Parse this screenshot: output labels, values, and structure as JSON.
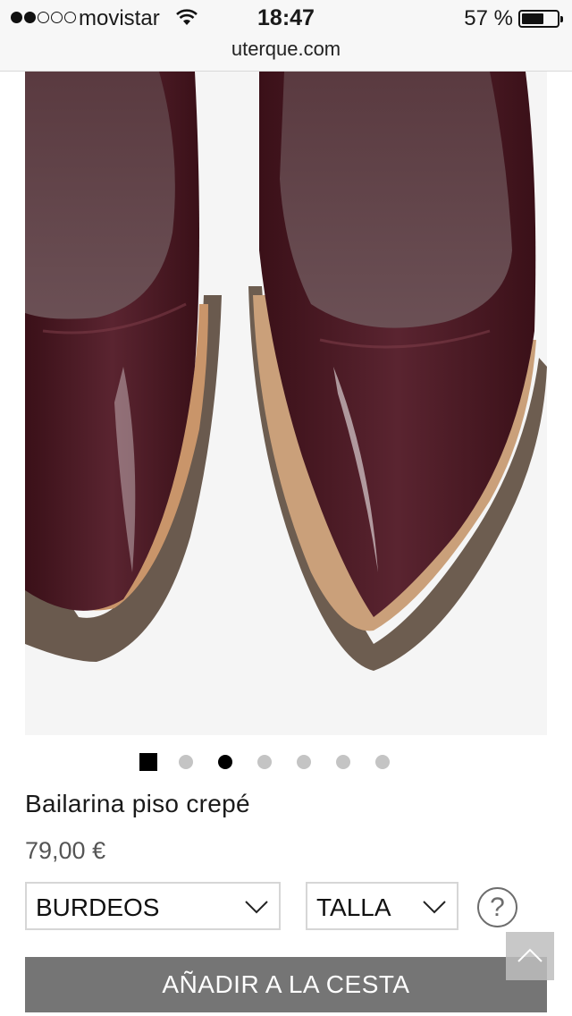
{
  "status_bar": {
    "carrier": "movistar",
    "time": "18:47",
    "battery": "57 %",
    "battery_level": 0.57,
    "signal_bars": 2
  },
  "browser": {
    "url": "uterque.com"
  },
  "carousel": {
    "dot_count": 7,
    "active_index": 2
  },
  "product": {
    "name": "Bailarina piso crepé",
    "price": "79,00 €",
    "color_value": "BURDEOS",
    "size_value": "TALLA",
    "help_label": "?",
    "add_to_cart_label": "AÑADIR A LA CESTA"
  },
  "colors": {
    "product_burgundy": "#4e1c24",
    "button_gray": "#757575"
  },
  "icons": {
    "wifi": "wifi-icon",
    "chevron": "chevron-down-icon",
    "help": "help-icon",
    "scroll_up": "chevron-up-icon"
  }
}
